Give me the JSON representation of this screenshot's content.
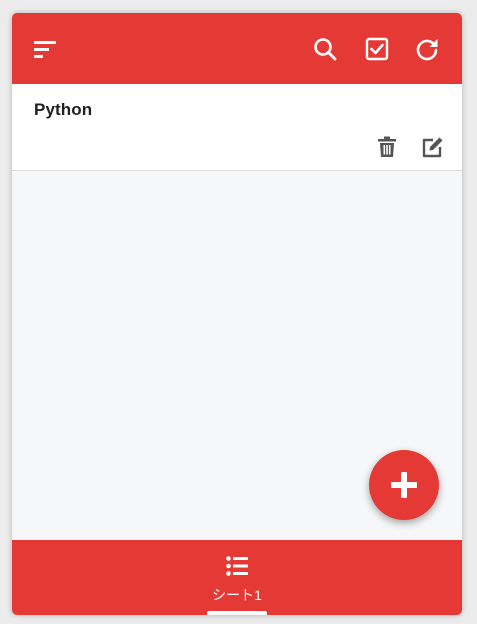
{
  "colors": {
    "primary": "#e53935",
    "background": "#f6f7f9",
    "card": "#ffffff",
    "text": "#212121",
    "action_icon": "#555555"
  },
  "appbar": {
    "menu_icon": "sort-menu-icon",
    "actions": [
      "search-icon",
      "checkbox-checked-icon",
      "refresh-icon"
    ]
  },
  "list": {
    "items": [
      {
        "title": "Python",
        "actions": [
          "trash-icon",
          "edit-icon"
        ]
      }
    ]
  },
  "fab": {
    "icon": "plus-icon"
  },
  "bottom_tabs": [
    {
      "label": "シート1",
      "icon": "list-icon",
      "selected": true
    }
  ]
}
